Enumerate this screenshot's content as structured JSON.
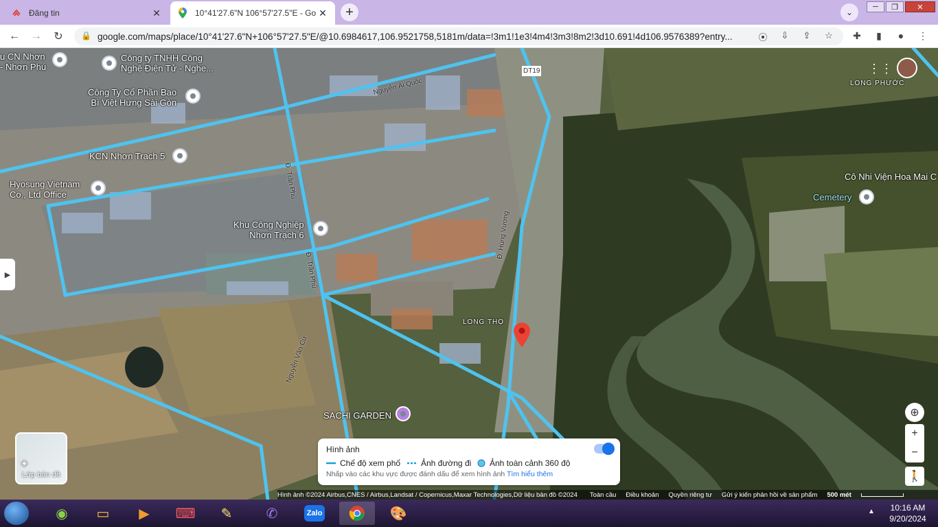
{
  "browser": {
    "tabs": [
      {
        "title": "Đăng tin",
        "icon": "chotot-icon",
        "active": false
      },
      {
        "title": "10°41'27.6\"N 106°57'27.5\"E - Go",
        "icon": "maps-pin-icon",
        "active": true
      }
    ],
    "url": "google.com/maps/place/10°41'27.6\"N+106°57'27.5\"E/@10.6984617,106.9521758,5181m/data=!3m1!1e3!4m4!3m3!8m2!3d10.691!4d106.9576389?entry..."
  },
  "map": {
    "places": [
      {
        "name": "Công ty TNHH Công\nNghệ Điện Tử - Nghe...",
        "id": "cong-ty-tnhh"
      },
      {
        "name": "u CN Nhơn\n- Nhơn Phú",
        "id": "kcn-nhon-phu"
      },
      {
        "name": "Công Ty Cổ Phần Bao\nBì Việt Hưng Sài Gòn",
        "id": "bao-bi-viet-hung"
      },
      {
        "name": "KCN Nhơn Trạch 5",
        "id": "kcn-nhon-trach-5"
      },
      {
        "name": "Hyosung Vietnam\nCo., Ltd Office",
        "id": "hyosung"
      },
      {
        "name": "Khu Công Nghiệp\nNhơn Trạch 6",
        "id": "kcn-nhon-trach-6"
      },
      {
        "name": "SACHI GARDEN",
        "id": "sachi-garden"
      },
      {
        "name": "Cô Nhi Viện Hoa Mai C",
        "id": "co-nhi-vien"
      },
      {
        "name": "Cemetery",
        "id": "cemetery"
      }
    ],
    "areas": {
      "long_tho": "LONG THỌ",
      "long_phuoc": "LONG PHƯỚC"
    },
    "roads": {
      "nguyen_ai_quoc": "Nguyễn Ái Quốc",
      "dt19": "DT19",
      "tran_phu": "Đ. Trần Phú",
      "hung_vuong": "Đ. Hùng Vương",
      "nguyen_van_ci": "Nguyễn Văn Cừ",
      "tran_phu_2": "Đ. Trần Phú"
    },
    "layers_label": "Lớp bản đồ",
    "imagery_panel": {
      "title": "Hình ảnh",
      "legend": [
        "Chế độ xem phố",
        "Ảnh đường đi",
        "Ảnh toàn cảnh 360 độ"
      ],
      "hint": "Nhấp vào các khu vực được đánh dấu để xem hình ảnh",
      "link": "Tìm hiểu thêm",
      "toggle_on": true
    },
    "footer": {
      "attribution": "Hình ảnh ©2024 Airbus,CNES / Airbus,Landsat / Copernicus,Maxar Technologies,Dữ liệu bản đồ ©2024",
      "links": [
        "Toàn cầu",
        "Điều khoản",
        "Quyền riêng tư",
        "Gửi ý kiến phản hồi về sản phẩm"
      ],
      "scale": "500 mét"
    }
  },
  "taskbar": {
    "time": "10:16 AM",
    "date": "9/20/2024"
  }
}
